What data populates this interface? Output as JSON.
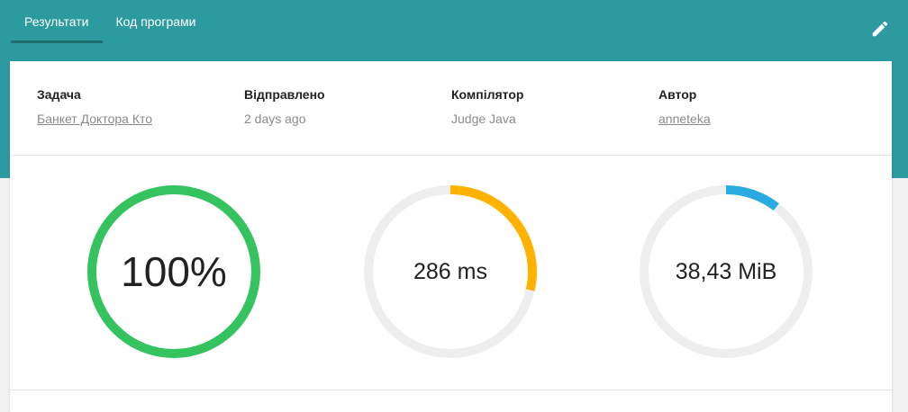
{
  "tabs": [
    {
      "label": "Результати",
      "active": true
    },
    {
      "label": "Код програми",
      "active": false
    }
  ],
  "header": {
    "edit_icon": "pencil-icon",
    "bg_color": "#2c9b9f"
  },
  "info": {
    "task": {
      "label": "Задача",
      "value": "Банкет Доктора Кто"
    },
    "sent": {
      "label": "Відправлено",
      "value": "2 days ago"
    },
    "compiler": {
      "label": "Компілятор",
      "value": "Judge Java"
    },
    "author": {
      "label": "Автор",
      "value": "anneteka"
    }
  },
  "gauges": [
    {
      "text": "100%",
      "fraction": 1.0,
      "color": "#34c35e"
    },
    {
      "text": "286 ms",
      "fraction": 0.286,
      "color": "#ffb300"
    },
    {
      "text": "38,43 MiB",
      "fraction": 0.105,
      "color": "#29abe2"
    }
  ]
}
